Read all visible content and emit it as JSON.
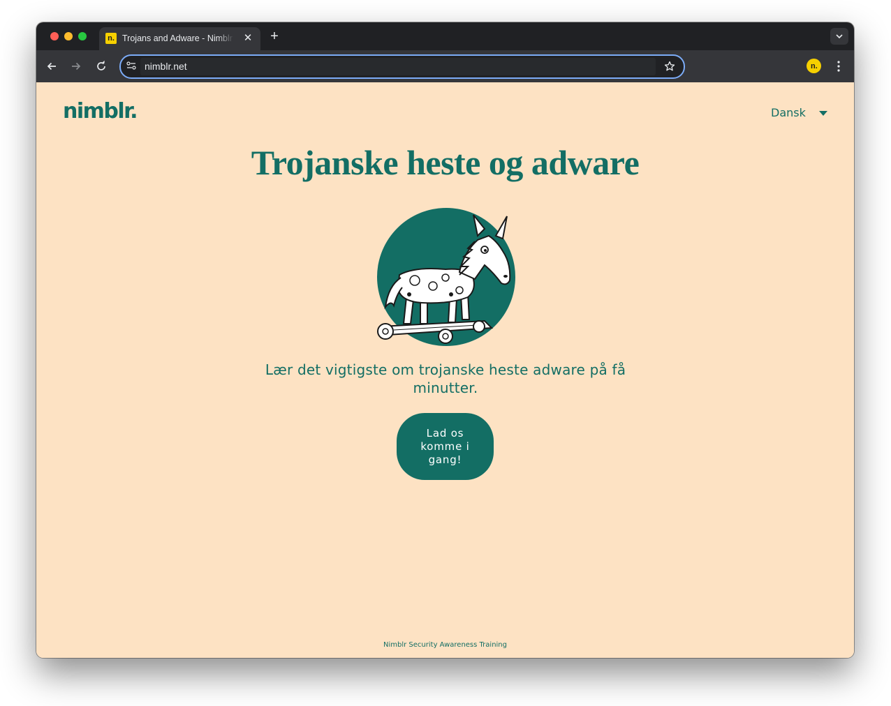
{
  "browser": {
    "tab": {
      "title": "Trojans and Adware - Nimblr Security Awareness Training",
      "favicon": "n."
    },
    "address": {
      "url": "nimblr.net"
    },
    "profile": {
      "initial": "n."
    }
  },
  "page": {
    "logo": "nimblr.",
    "language": "Dansk",
    "title": "Trojanske heste og adware",
    "hero_image": "trojan-horse-illustration",
    "subtitle": "Lær det vigtigste om trojanske heste adware på få minutter.",
    "cta_label": "Lad os komme i gang!",
    "footer": "Nimblr Security Awareness Training"
  },
  "colors": {
    "brand": "#136e64",
    "background": "#fde2c3",
    "browser_frame": "#202124",
    "toolbar": "#35363a",
    "focus_ring": "#7cacf8",
    "favicon": "#f6d000"
  }
}
